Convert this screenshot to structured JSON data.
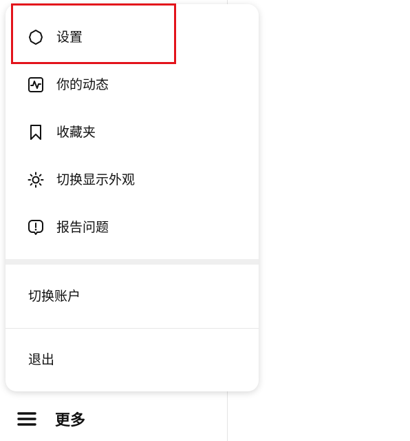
{
  "menu": {
    "items": [
      {
        "label": "设置",
        "icon": "gear-icon"
      },
      {
        "label": "你的动态",
        "icon": "activity-icon"
      },
      {
        "label": "收藏夹",
        "icon": "bookmark-icon"
      },
      {
        "label": "切换显示外观",
        "icon": "sun-icon"
      },
      {
        "label": "报告问题",
        "icon": "report-icon"
      }
    ],
    "switch_account": "切换账户",
    "logout": "退出"
  },
  "more": {
    "label": "更多",
    "icon": "hamburger-menu-icon"
  },
  "highlight_color": "#e3131b"
}
